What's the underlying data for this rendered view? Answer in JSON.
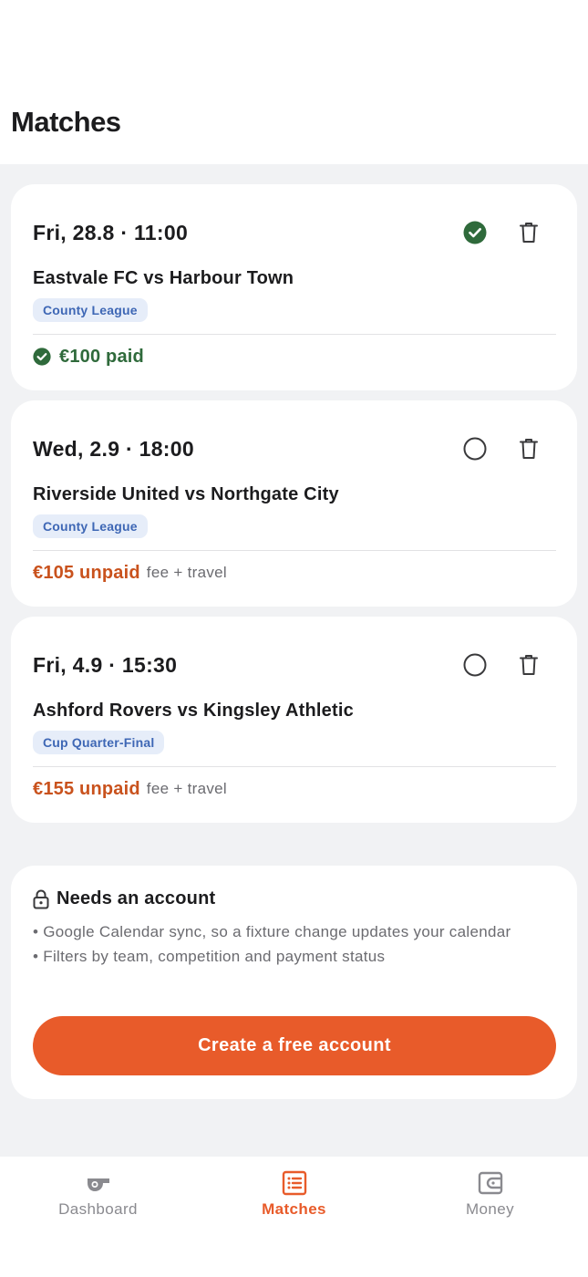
{
  "header": {
    "title": "Matches"
  },
  "colors": {
    "accent": "#e85b2a",
    "paid": "#2f6a3b",
    "unpaid": "#c9521d",
    "badge_bg": "#e6edf9",
    "badge_text": "#3e67b5"
  },
  "matches": [
    {
      "date": "Fri, 28.8 · 11:00",
      "teams": "Eastvale FC vs Harbour Town",
      "competition": "County League",
      "status": "paid",
      "status_icon": "check-circle-icon",
      "payment_amount": "€100 paid",
      "payment_note": ""
    },
    {
      "date": "Wed, 2.9 · 18:00",
      "teams": "Riverside United vs Northgate City",
      "competition": "County League",
      "status": "unpaid",
      "status_icon": "empty-circle-icon",
      "payment_amount": "€105 unpaid",
      "payment_note": "fee + travel"
    },
    {
      "date": "Fri, 4.9 · 15:30",
      "teams": "Ashford Rovers vs Kingsley Athletic",
      "competition": "Cup Quarter-Final",
      "status": "unpaid",
      "status_icon": "empty-circle-icon",
      "payment_amount": "€155 unpaid",
      "payment_note": "fee + travel"
    }
  ],
  "promo": {
    "title": "Needs an account",
    "bullets": [
      "• Google Calendar sync, so a fixture change updates your calendar",
      "• Filters by team, competition and payment status"
    ],
    "cta_label": "Create a free account"
  },
  "tabbar": {
    "tabs": [
      {
        "label": "Dashboard",
        "icon": "whistle-icon",
        "active": false
      },
      {
        "label": "Matches",
        "icon": "list-icon",
        "active": true
      },
      {
        "label": "Money",
        "icon": "wallet-icon",
        "active": false
      }
    ]
  }
}
